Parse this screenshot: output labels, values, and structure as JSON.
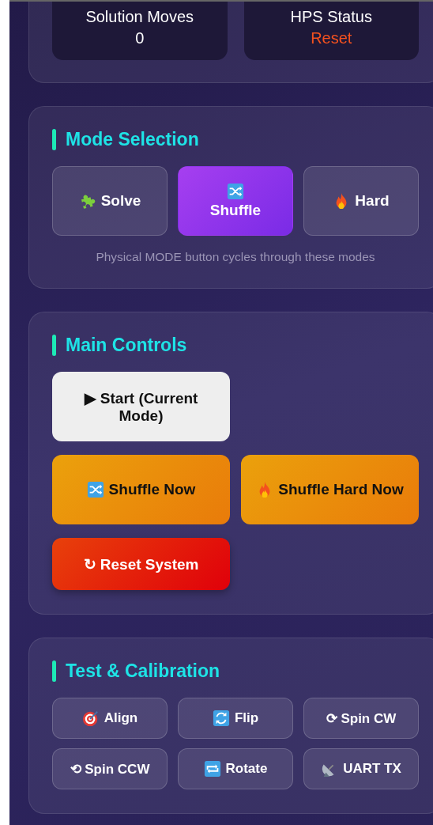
{
  "stats": [
    {
      "label": "Solution Moves",
      "value": "0",
      "kind": "plain"
    },
    {
      "label": "HPS Status",
      "value": "Reset",
      "kind": "alert"
    }
  ],
  "mode_selection": {
    "title": "Mode Selection",
    "modes": [
      {
        "label": "Solve",
        "selected": false
      },
      {
        "label": "Shuffle",
        "selected": true
      },
      {
        "label": "Hard",
        "selected": false
      }
    ],
    "note": "Physical MODE button cycles through these modes"
  },
  "main_controls": {
    "title": "Main Controls",
    "buttons": [
      {
        "label": "▶ Start (Current Mode)",
        "kind": "light"
      },
      {
        "label": "Shuffle Now",
        "kind": "orange"
      },
      {
        "label": "Shuffle Hard Now",
        "kind": "orange"
      },
      {
        "label": "↻ Reset System",
        "kind": "red"
      }
    ]
  },
  "test_calibration": {
    "title": "Test & Calibration",
    "buttons": [
      {
        "label": "Align"
      },
      {
        "label": "Flip"
      },
      {
        "label": "⟳ Spin CW"
      },
      {
        "label": "⟲ Spin CCW"
      },
      {
        "label": "Rotate"
      },
      {
        "label": "UART TX"
      }
    ]
  }
}
